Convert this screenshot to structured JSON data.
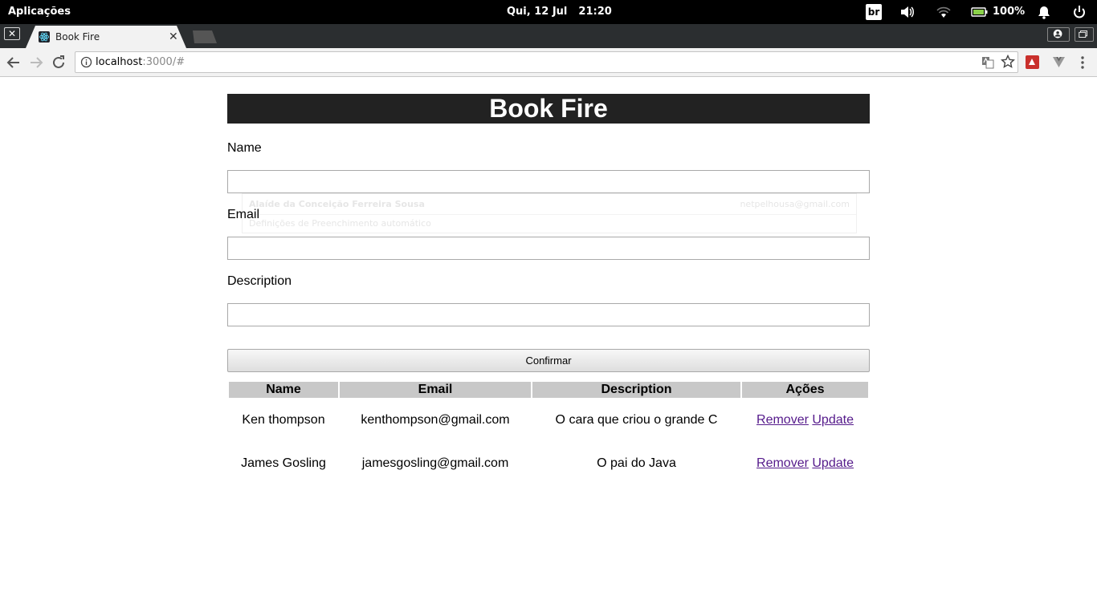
{
  "system_bar": {
    "apps_label": "Aplicações",
    "date": "Qui, 12 Jul",
    "time": "21:20",
    "keyboard_layout": "br",
    "battery_percent": "100%"
  },
  "browser": {
    "tab_title": "Book Fire",
    "url_host": "localhost",
    "url_path": ":3000/#"
  },
  "app": {
    "title": "Book Fire",
    "form": {
      "name_label": "Name",
      "name_value": "",
      "email_label": "Email",
      "email_value": "",
      "description_label": "Description",
      "description_value": "",
      "confirm_label": "Confirmar"
    },
    "autofill": {
      "name": "Alaíde da Conceição Ferreira Sousa",
      "email": "netpelhousa@gmail.com",
      "settings": "Definições de Preenchimento automático"
    },
    "table": {
      "headers": [
        "Name",
        "Email",
        "Description",
        "Ações"
      ],
      "rows": [
        {
          "name": "Ken thompson",
          "email": "kenthompson@gmail.com",
          "description": "O cara que criou o grande C",
          "remove": "Remover",
          "update": "Update"
        },
        {
          "name": "James Gosling",
          "email": "jamesgosling@gmail.com",
          "description": "O pai do Java",
          "remove": "Remover",
          "update": "Update"
        }
      ]
    }
  },
  "colors": {
    "header_bg": "#222222",
    "table_header_bg": "#c8c8c8",
    "link_visited": "#551a8b"
  }
}
